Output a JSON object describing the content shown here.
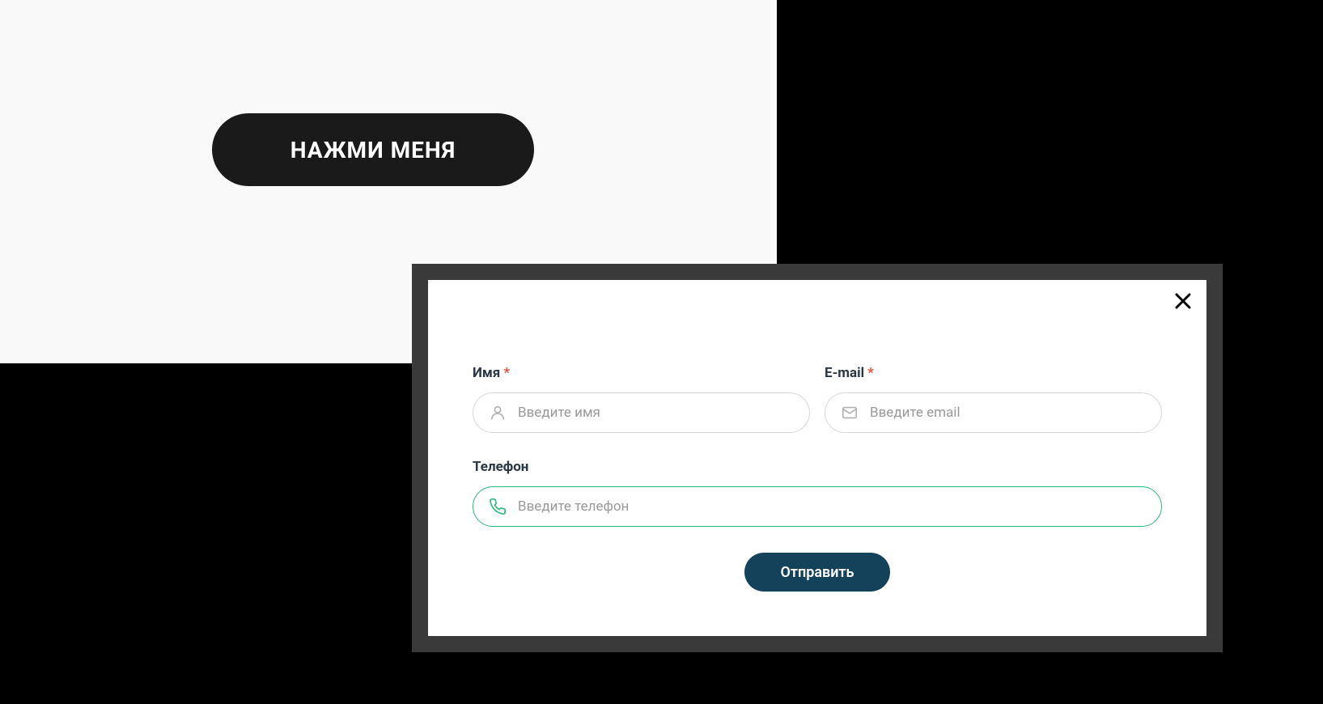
{
  "main_button": {
    "label": "НАЖМИ МЕНЯ"
  },
  "modal": {
    "fields": {
      "name": {
        "label": "Имя",
        "required": true,
        "placeholder": "Введите имя"
      },
      "email": {
        "label": "E-mail",
        "required": true,
        "placeholder": "Введите email"
      },
      "phone": {
        "label": "Телефон",
        "required": false,
        "placeholder": "Введите телефон"
      }
    },
    "submit_label": "Отправить"
  }
}
